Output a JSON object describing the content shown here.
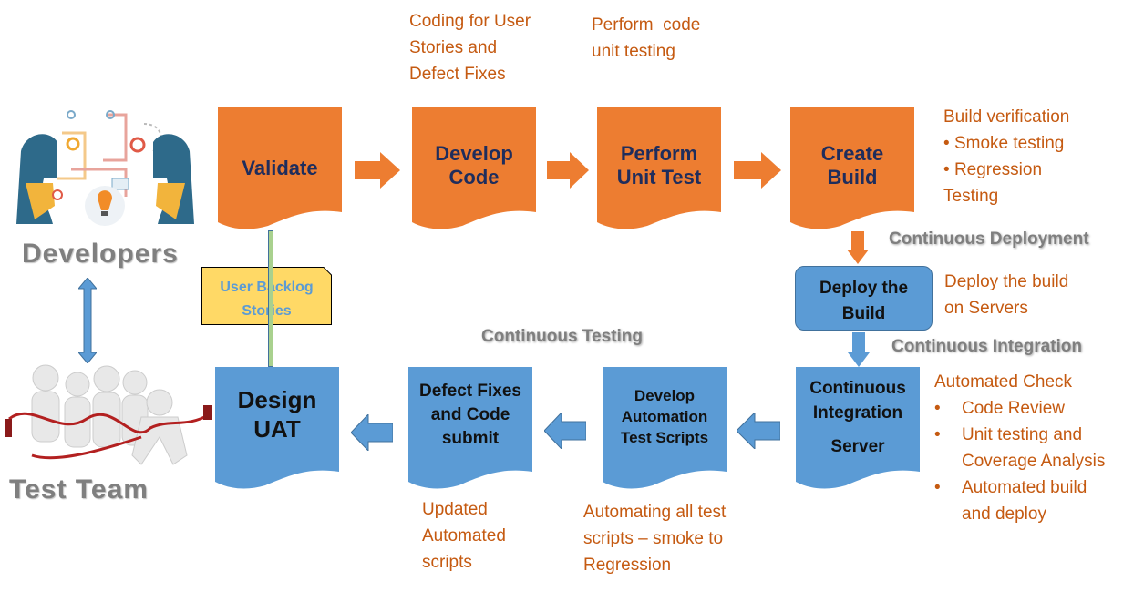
{
  "roles": {
    "developers": "Developers",
    "test_team": "Test Team"
  },
  "colors": {
    "orange": "#ed7d31",
    "blue": "#5b9bd5",
    "note_text": "#c55a11",
    "step_text_dark": "#1f2d5c",
    "sticky_note": "#ffd966",
    "gray_label": "#7f7f7f",
    "connector_green": "#a9d18e"
  },
  "top_row": [
    {
      "label_lines": [
        "Validate"
      ]
    },
    {
      "label_lines": [
        "Develop",
        "Code"
      ]
    },
    {
      "label_lines": [
        "Perform",
        "Unit Test"
      ]
    },
    {
      "label_lines": [
        "Create",
        "Build"
      ]
    }
  ],
  "deploy": {
    "label_lines": [
      "Deploy the",
      "Build"
    ]
  },
  "bottom_row": [
    {
      "label_lines": [
        "Continuous",
        "Integration",
        "Server"
      ]
    },
    {
      "label_lines": [
        "Develop",
        "Automation",
        "Test Scripts"
      ]
    },
    {
      "label_lines": [
        "Defect Fixes",
        "and Code",
        "submit"
      ]
    },
    {
      "label_lines": [
        "Design",
        "UAT"
      ]
    }
  ],
  "sticky_note": {
    "label_lines": [
      "User Backlog",
      "Stories"
    ]
  },
  "phase_labels": {
    "continuous_deployment": "Continuous Deployment",
    "continuous_integration": "Continuous Integration",
    "continuous_testing": "Continuous Testing"
  },
  "notes": {
    "develop_code": [
      "Coding for User",
      "Stories and",
      "Defect Fixes"
    ],
    "unit_test": [
      "Perform  code",
      "unit testing"
    ],
    "build_verification": {
      "title": "Build verification",
      "bullets": [
        "Smoke testing",
        "Regression"
      ],
      "tail": "Testing"
    },
    "deploy": [
      "Deploy the build",
      "on Servers"
    ],
    "automated_check": {
      "title": "Automated Check",
      "bullets": [
        [
          "Code Review"
        ],
        [
          "Unit testing and",
          "Coverage Analysis"
        ],
        [
          "Automated build",
          "and deploy"
        ]
      ]
    },
    "updated_scripts": [
      "Updated",
      "Automated",
      "scripts"
    ],
    "automating_tests": [
      "Automating all test",
      "scripts – smoke to",
      "Regression"
    ]
  },
  "bullet_glyph": "•"
}
